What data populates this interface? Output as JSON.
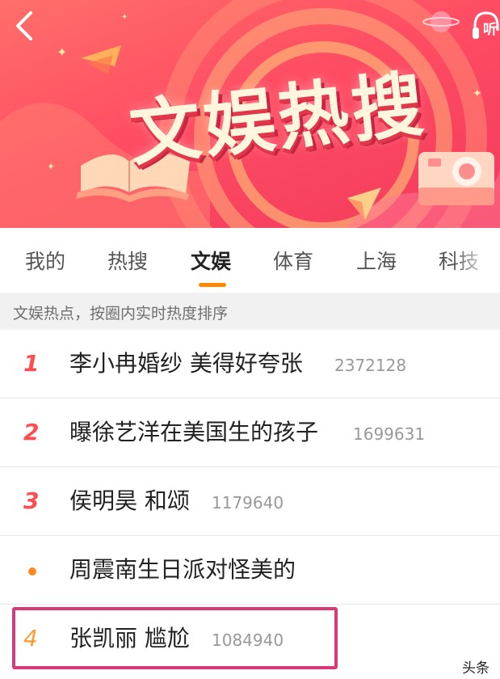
{
  "header": {
    "back_icon": "chevron-left-icon",
    "listen_icon": "headphones-icon",
    "listen_label": "听",
    "title": "文娱热搜"
  },
  "tabs": [
    {
      "label": "我的",
      "active": false
    },
    {
      "label": "热搜",
      "active": false
    },
    {
      "label": "文娱",
      "active": true
    },
    {
      "label": "体育",
      "active": false
    },
    {
      "label": "上海",
      "active": false
    },
    {
      "label": "科技",
      "active": false
    }
  ],
  "hint": "文娱热点，按圈内实时热度排序",
  "list": [
    {
      "rank": "1",
      "title": "李小冉婚纱 美得好夸张",
      "count": "2372128"
    },
    {
      "rank": "2",
      "title": "曝徐艺洋在美国生的孩子",
      "count": "1699631"
    },
    {
      "rank": "3",
      "title": "侯明昊 和颂",
      "count": "1179640"
    },
    {
      "rank": "",
      "title": "周震南生日派对怪美的",
      "count": ""
    },
    {
      "rank": "4",
      "title": "张凯丽 尴尬",
      "count": "1084940"
    }
  ],
  "watermark": "头条",
  "colors": {
    "banner": "#ff4d63",
    "accent_orange": "#ff8a00",
    "rank_red": "#ff4d4f",
    "highlight": "#d83a78"
  }
}
